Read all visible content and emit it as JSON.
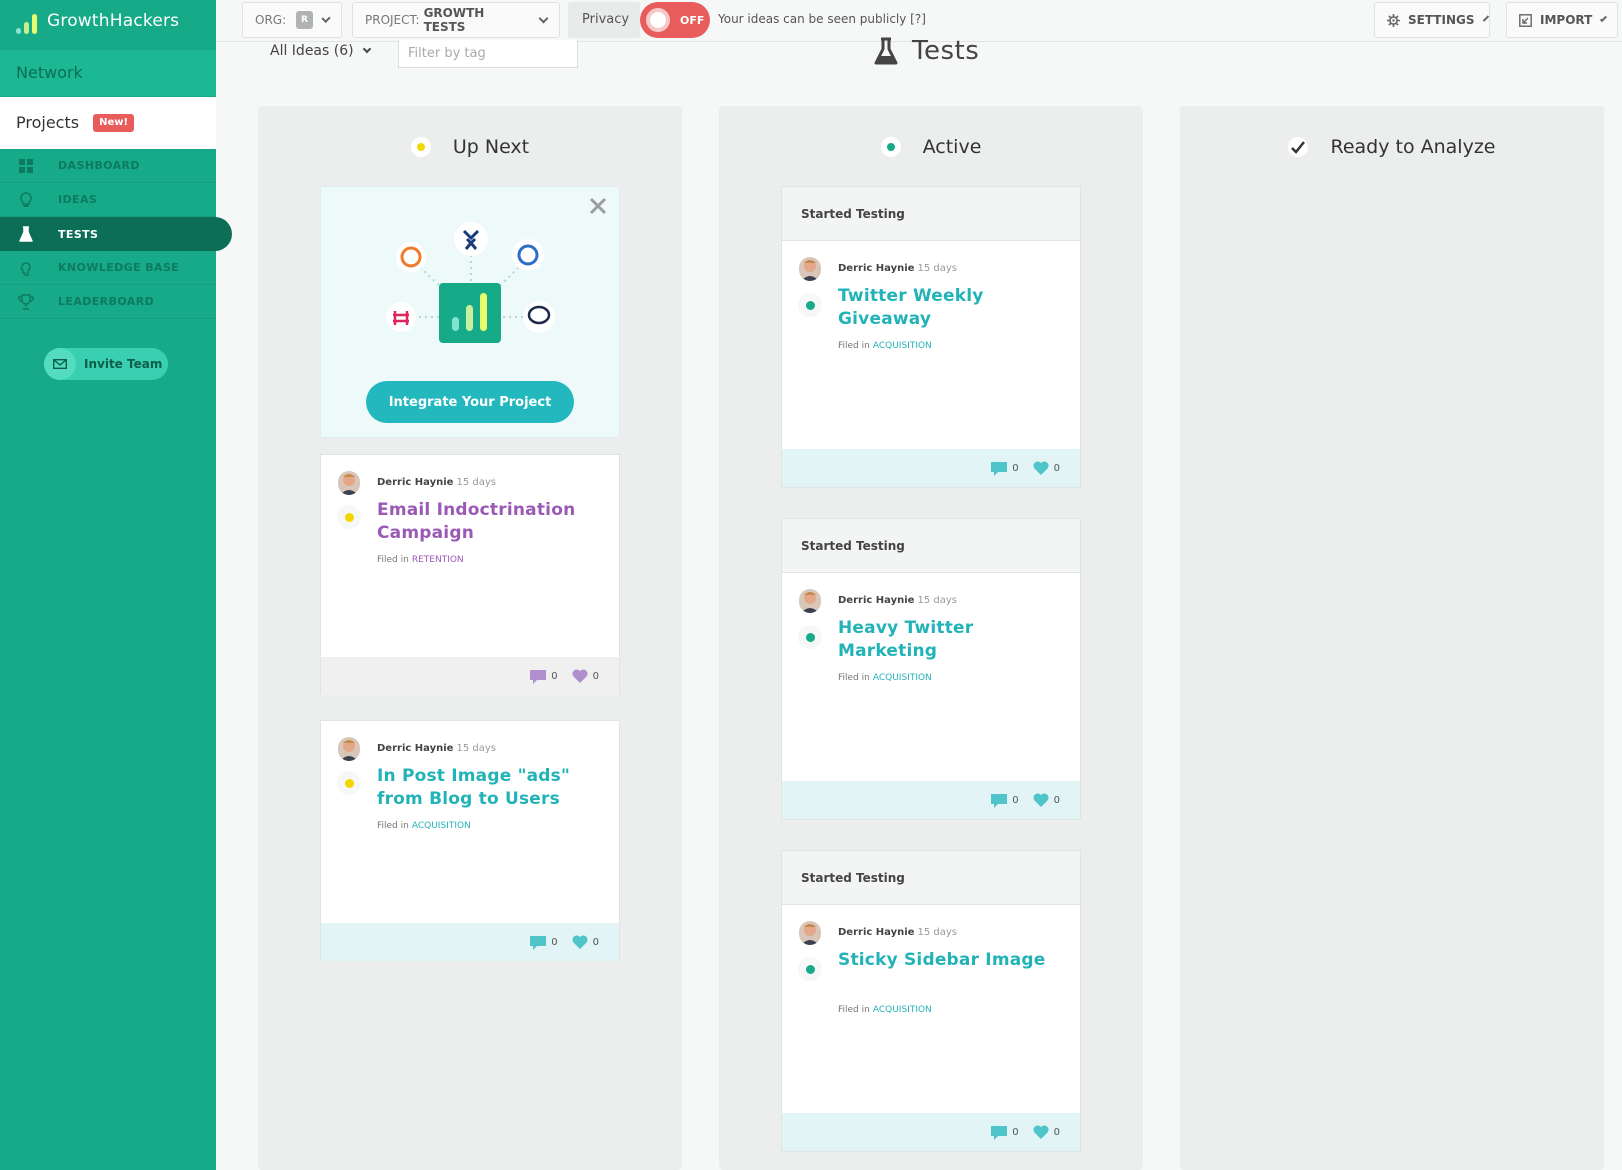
{
  "brand": {
    "name": "GrowthHackers"
  },
  "sidebar": {
    "network_label": "Network",
    "projects_label": "Projects",
    "projects_badge": "New!",
    "items": [
      {
        "label": "DASHBOARD",
        "icon": "grid-icon"
      },
      {
        "label": "IDEAS",
        "icon": "lightbulb-icon"
      },
      {
        "label": "TESTS",
        "icon": "flask-icon"
      },
      {
        "label": "KNOWLEDGE BASE",
        "icon": "brain-icon"
      },
      {
        "label": "LEADERBOARD",
        "icon": "trophy-icon"
      }
    ],
    "active_item": "TESTS",
    "invite_label": "Invite Team"
  },
  "topbar": {
    "org_label": "ORG:",
    "org_chip": "R",
    "project_label": "PROJECT:",
    "project_name": "GROWTH TESTS",
    "privacy_label": "Privacy",
    "toggle_state": "OFF",
    "privacy_note": "Your ideas can be seen publicly [?]",
    "settings_label": "SETTINGS",
    "import_label": "IMPORT"
  },
  "filters": {
    "all_ideas": "All Ideas (6)",
    "tag_placeholder": "Filter by tag"
  },
  "page_title": "Tests",
  "colors": {
    "sidebar": "#16aa89",
    "accent": "#22b8be",
    "retention": "#9b59b6",
    "acquisition": "#22b3b8",
    "up_next": "#f2d600",
    "active": "#16aa89",
    "danger": "#e85c5c"
  },
  "columns": {
    "up_next": {
      "title": "Up Next",
      "integration": {
        "button_label": "Integrate Your Project"
      },
      "cards": [
        {
          "author": "Derric Haynie",
          "age": "15 days",
          "title": "Email Indoctrination Campaign",
          "filed_prefix": "Filed in",
          "category": "RETENTION",
          "comments": "0",
          "likes": "0"
        },
        {
          "author": "Derric Haynie",
          "age": "15 days",
          "title": "In Post Image \"ads\" from Blog to Users",
          "filed_prefix": "Filed in",
          "category": "ACQUISITION",
          "comments": "0",
          "likes": "0"
        }
      ]
    },
    "active": {
      "title": "Active",
      "cards": [
        {
          "header": "Started Testing",
          "author": "Derric Haynie",
          "age": "15 days",
          "title": "Twitter Weekly Giveaway",
          "filed_prefix": "Filed in",
          "category": "ACQUISITION",
          "comments": "0",
          "likes": "0"
        },
        {
          "header": "Started Testing",
          "author": "Derric Haynie",
          "age": "15 days",
          "title": "Heavy Twitter Marketing",
          "filed_prefix": "Filed in",
          "category": "ACQUISITION",
          "comments": "0",
          "likes": "0"
        },
        {
          "header": "Started Testing",
          "author": "Derric Haynie",
          "age": "15 days",
          "title": "Sticky Sidebar Image",
          "filed_prefix": "Filed in",
          "category": "ACQUISITION",
          "comments": "0",
          "likes": "0"
        }
      ]
    },
    "ready": {
      "title": "Ready to Analyze"
    }
  }
}
